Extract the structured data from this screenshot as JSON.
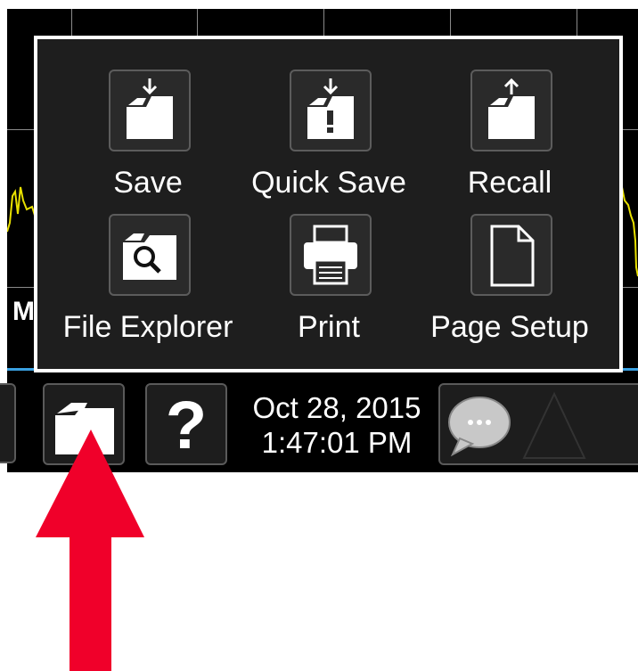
{
  "screen": {
    "marker_label": "M"
  },
  "menu": {
    "items": [
      {
        "label": "Save",
        "icon": "folder-save-icon"
      },
      {
        "label": "Quick Save",
        "icon": "folder-quick-save-icon"
      },
      {
        "label": "Recall",
        "icon": "folder-recall-icon"
      },
      {
        "label": "File Explorer",
        "icon": "file-explorer-icon"
      },
      {
        "label": "Print",
        "icon": "printer-icon"
      },
      {
        "label": "Page Setup",
        "icon": "page-icon"
      }
    ]
  },
  "taskbar": {
    "help_label": "?",
    "date": "Oct 28, 2015",
    "time": "1:47:01 PM",
    "message_icon": "speech-bubble-icon",
    "warning_icon": "triangle-icon"
  },
  "colors": {
    "trace": "#e8e000",
    "arrow": "#f0002a",
    "status_bar": "#3aa0e0",
    "menu_border": "#ffffff"
  }
}
